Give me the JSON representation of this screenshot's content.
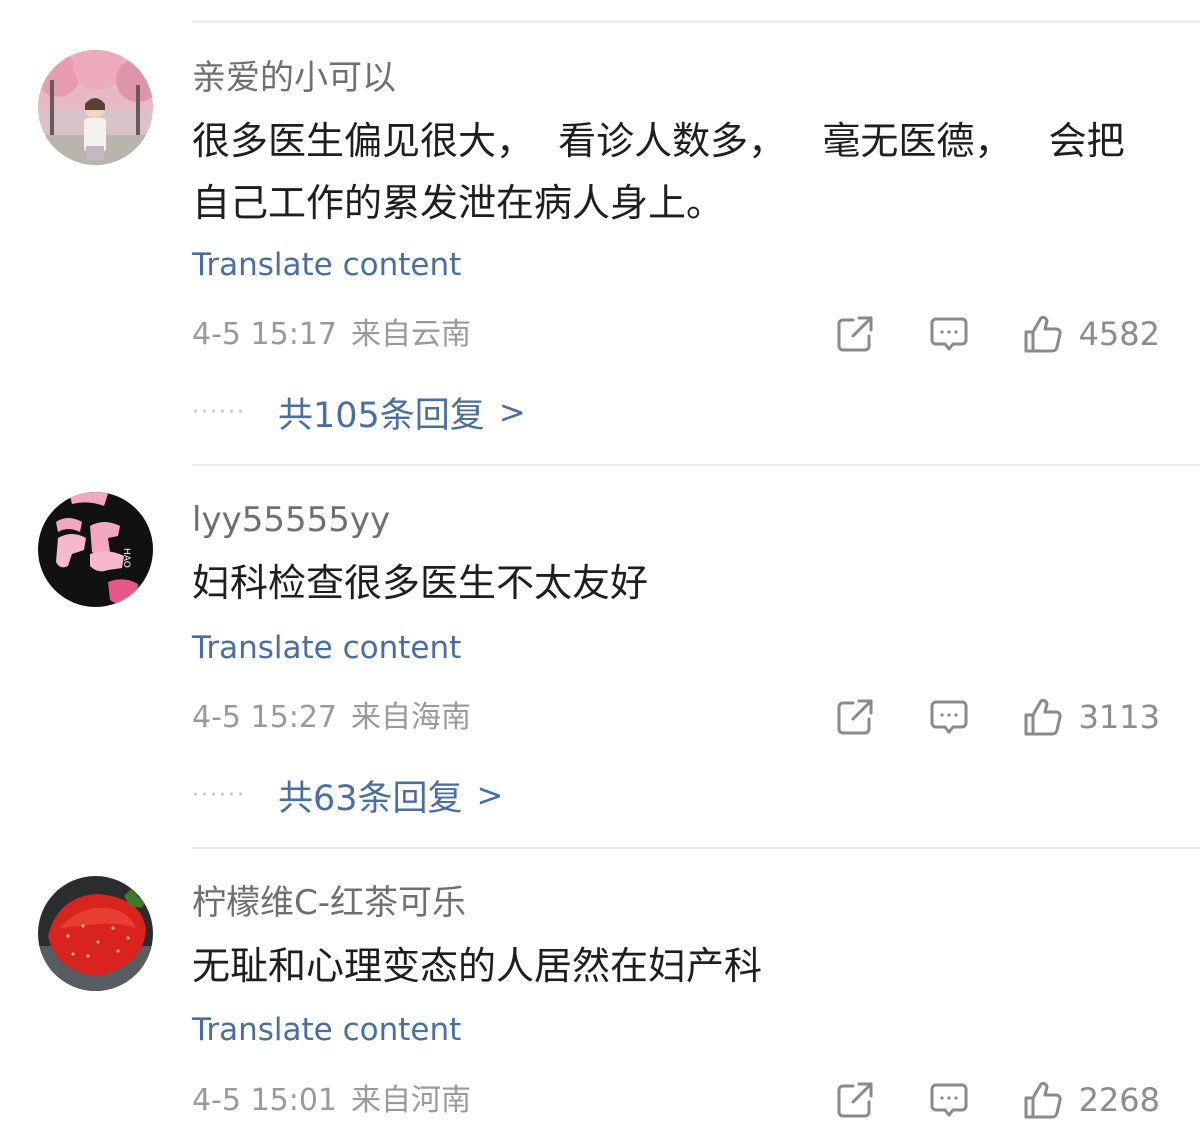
{
  "comments": [
    {
      "username": "亲爱的小可以",
      "content": "很多医生偏见很大，  看诊人数多，   毫无医德，   会把自己工作的累发泄在病人身上。",
      "translate_label": "Translate content",
      "time": "4-5 15:17",
      "location": "来自云南",
      "likes": "4582",
      "replies_label": "共105条回复",
      "avatar_icon": "photo-avatar-icon"
    },
    {
      "username": "lyy55555yy",
      "content": "妇科检查很多医生不太友好",
      "translate_label": "Translate content",
      "time": "4-5 15:27",
      "location": "来自海南",
      "likes": "3113",
      "replies_label": "共63条回复",
      "avatar_icon": "hao-avatar-icon"
    },
    {
      "username": "柠檬维C-红茶可乐",
      "content": "无耻和心理变态的人居然在妇产科",
      "translate_label": "Translate content",
      "time": "4-5 15:01",
      "location": "来自河南",
      "likes": "2268",
      "avatar_icon": "strawberry-avatar-icon"
    }
  ],
  "reply_chevron": ">",
  "reply_dots": "······",
  "colors": {
    "link": "#4a6ea1",
    "meta": "#9a9a9a",
    "username": "#6f6f6f",
    "divider": "#ececec"
  }
}
